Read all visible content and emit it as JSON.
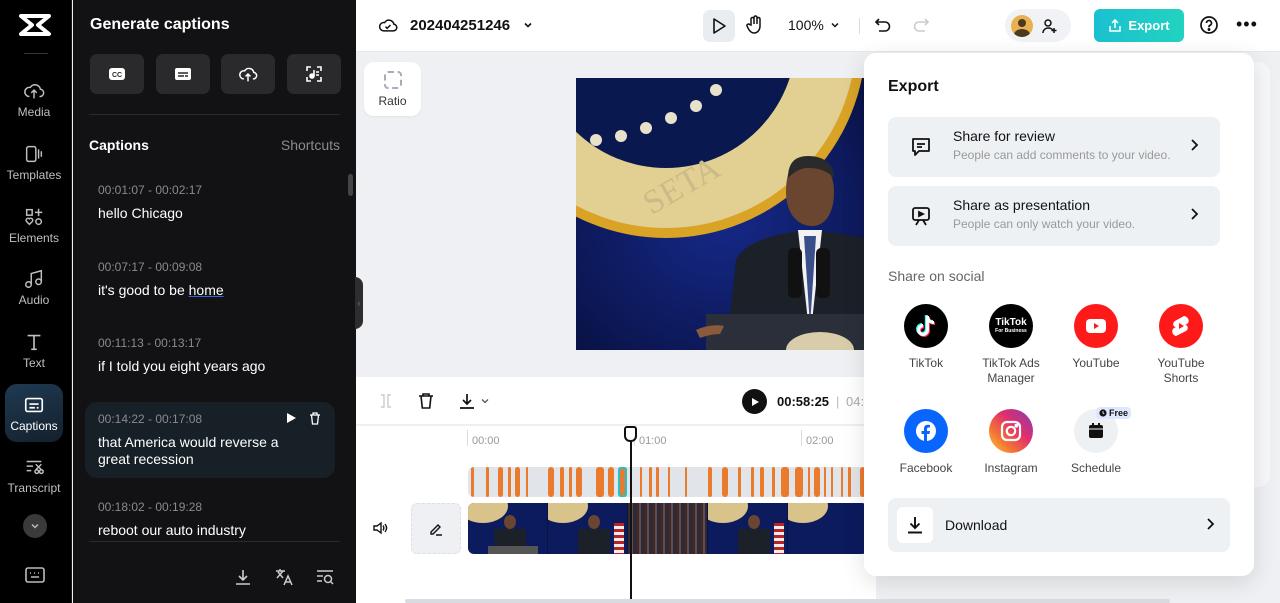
{
  "rail": {
    "items": [
      {
        "label": "Media",
        "icon": "cloud-upload-icon"
      },
      {
        "label": "Templates",
        "icon": "templates-icon"
      },
      {
        "label": "Elements",
        "icon": "elements-icon"
      },
      {
        "label": "Audio",
        "icon": "music-note-icon"
      },
      {
        "label": "Text",
        "icon": "text-icon"
      },
      {
        "label": "Captions",
        "icon": "captions-icon",
        "active": true
      },
      {
        "label": "Transcript",
        "icon": "transcript-icon"
      }
    ]
  },
  "panel": {
    "title": "Generate captions",
    "gen_buttons": [
      "auto-captions-icon",
      "manual-captions-icon",
      "upload-captions-icon",
      "lyrics-captions-icon"
    ],
    "captions_title": "Captions",
    "shortcuts_label": "Shortcuts",
    "captions": [
      {
        "time": "00:01:07 - 00:02:17",
        "text": "hello Chicago"
      },
      {
        "time": "00:07:17 - 00:09:08",
        "text_before": "it's good to be ",
        "text_underlined": "home"
      },
      {
        "time": "00:11:13 - 00:13:17",
        "text": "if I told you eight years ago"
      },
      {
        "time": "00:14:22 - 00:17:08",
        "text": "that America would reverse a great recession",
        "selected": true
      },
      {
        "time": "00:18:02 - 00:19:28",
        "text": "reboot our auto industry"
      }
    ]
  },
  "topbar": {
    "project_name": "202404251246",
    "zoom": "100%",
    "export_label": "Export"
  },
  "canvas": {
    "ratio_label": "Ratio"
  },
  "timeline": {
    "current_time": "00:58:25",
    "total_time_visible": "04:",
    "ruler": [
      "00:00",
      "01:00",
      "02:00"
    ]
  },
  "export_popover": {
    "title": "Export",
    "share_review": {
      "title": "Share for review",
      "subtitle": "People can add comments to your video."
    },
    "share_presentation": {
      "title": "Share as presentation",
      "subtitle": "People can only watch your video."
    },
    "social_title": "Share on social",
    "social": [
      {
        "label": "TikTok",
        "color": "#000000"
      },
      {
        "label": "TikTok Ads Manager",
        "color": "#000000"
      },
      {
        "label": "YouTube",
        "color": "#ff0000"
      },
      {
        "label": "YouTube Shorts",
        "color": "#ff0000"
      },
      {
        "label": "Facebook",
        "color": "#0866ff"
      },
      {
        "label": "Instagram",
        "color": "#e1306c"
      },
      {
        "label": "Schedule",
        "color": "#eef1f4"
      }
    ],
    "free_badge": "Free",
    "tiktok_business_text": "TikTok",
    "tiktok_business_sub": "For Business",
    "download_label": "Download"
  },
  "colors": {
    "accent": "#1cc4cf",
    "caption_marker": "#ea7a2c"
  }
}
